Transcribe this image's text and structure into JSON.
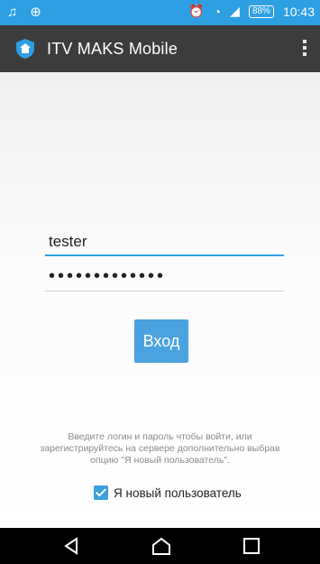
{
  "status_bar": {
    "time": "10:43",
    "battery": "88%",
    "left_icons": [
      "music-icon",
      "globe-icon"
    ],
    "right_icons": [
      "alarm-icon",
      "wifi-icon",
      "signal-icon",
      "battery-icon"
    ]
  },
  "app_bar": {
    "title": "ITV MAKS Mobile"
  },
  "login": {
    "username_value": "tester",
    "password_display": "•••••••••••••",
    "submit_label": "Вход"
  },
  "info": {
    "text": "Введите логин и пароль чтобы войти, или зарегистрируйтесь на сервере дополнительно выбрав опцию \"Я новый пользователь\"."
  },
  "register": {
    "label": "Я новый пользователь",
    "checked": true
  },
  "colors": {
    "status_bar": "#2e9fe3",
    "app_bar": "#3c3c3c",
    "accent": "#4aa3df"
  }
}
